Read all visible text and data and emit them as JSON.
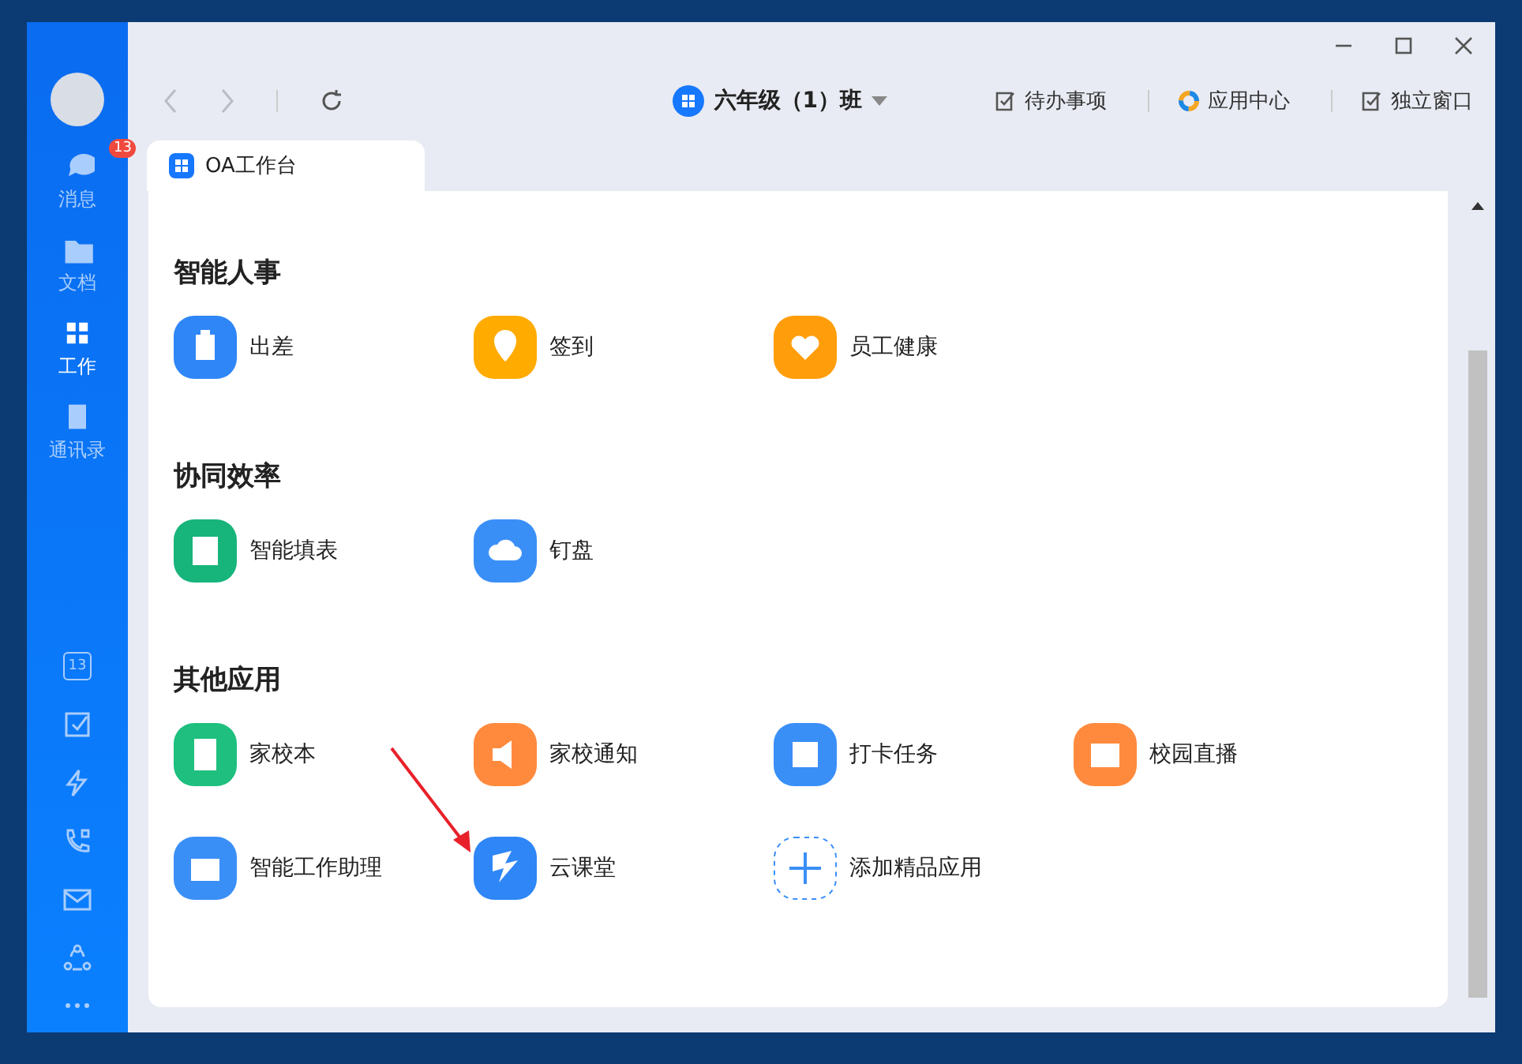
{
  "sidebar": {
    "items": [
      {
        "label": "消息",
        "badge": "13",
        "selected": false
      },
      {
        "label": "文档",
        "selected": false
      },
      {
        "label": "工作",
        "selected": true
      },
      {
        "label": "通讯录",
        "selected": false
      }
    ],
    "calendar_day": "13"
  },
  "toolbar": {
    "org": "六年级（1）班",
    "actions": [
      "待办事项",
      "应用中心",
      "独立窗口"
    ]
  },
  "tabs": [
    {
      "label": "OA工作台",
      "selected": true
    }
  ],
  "sections": [
    {
      "title": "智能人事",
      "apps": [
        {
          "label": "出差",
          "color": "#2f86f6",
          "kind": "app"
        },
        {
          "label": "签到",
          "color": "#ffab00",
          "kind": "app"
        },
        {
          "label": "员工健康",
          "color": "#ff9d0a",
          "kind": "app"
        }
      ]
    },
    {
      "title": "协同效率",
      "apps": [
        {
          "label": "智能填表",
          "color": "#17b47c",
          "kind": "app"
        },
        {
          "label": "钉盘",
          "color": "#3a8ff7",
          "kind": "app"
        }
      ]
    },
    {
      "title": "其他应用",
      "apps": [
        {
          "label": "家校本",
          "color": "#1ebf7f",
          "kind": "app"
        },
        {
          "label": "家校通知",
          "color": "#ff8a3d",
          "kind": "app"
        },
        {
          "label": "打卡任务",
          "color": "#3a8ff7",
          "kind": "app"
        },
        {
          "label": "校园直播",
          "color": "#ff8a3d",
          "kind": "app"
        },
        {
          "label": "智能工作助理",
          "color": "#3a8ff7",
          "kind": "app"
        },
        {
          "label": "云课堂",
          "color": "#2f86f6",
          "kind": "app"
        },
        {
          "label": "添加精品应用",
          "color": "#3a8ff7",
          "kind": "add"
        }
      ]
    }
  ]
}
